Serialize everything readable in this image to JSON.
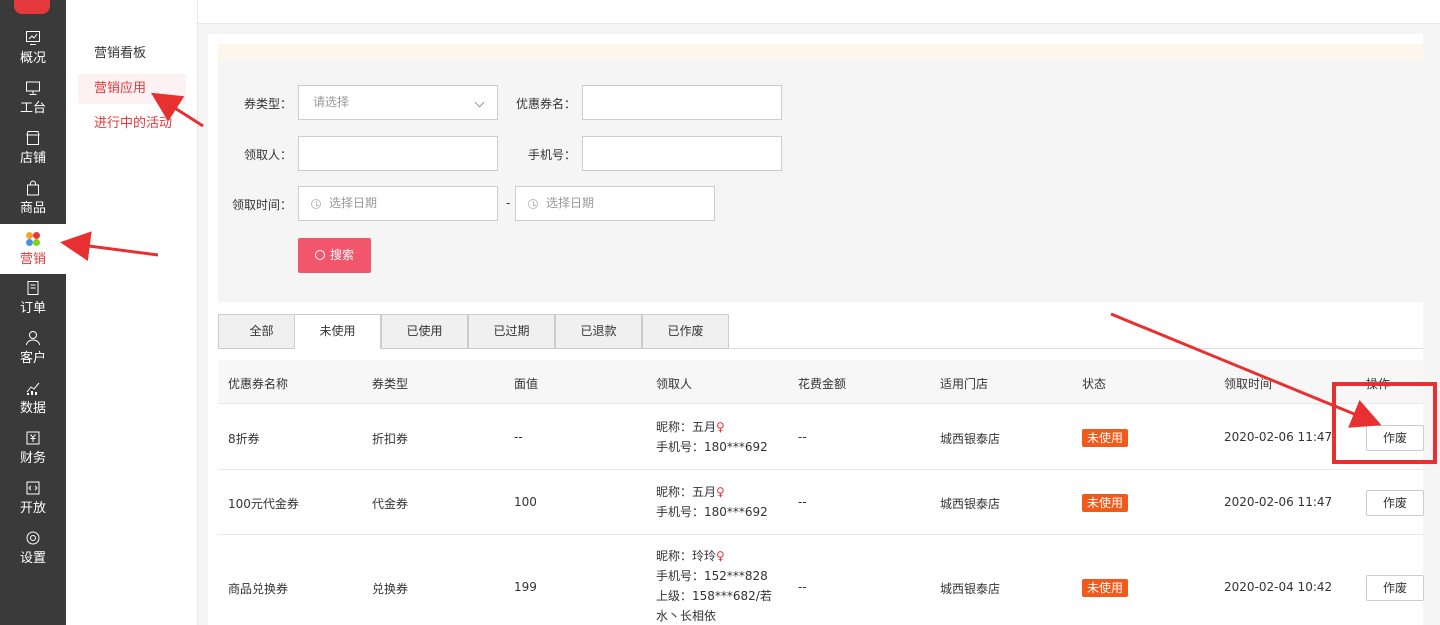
{
  "nav": {
    "items": [
      {
        "label": "概况",
        "icon": "dashboard-icon"
      },
      {
        "label": "工台",
        "icon": "desktop-icon"
      },
      {
        "label": "店铺",
        "icon": "store-icon"
      },
      {
        "label": "商品",
        "icon": "bag-icon"
      },
      {
        "label": "营销",
        "icon": "marketing-icon"
      },
      {
        "label": "订单",
        "icon": "order-icon"
      },
      {
        "label": "客户",
        "icon": "user-icon"
      },
      {
        "label": "数据",
        "icon": "chart-icon"
      },
      {
        "label": "财务",
        "icon": "finance-icon"
      },
      {
        "label": "开放",
        "icon": "code-icon"
      },
      {
        "label": "设置",
        "icon": "gear-icon"
      }
    ]
  },
  "submenu": {
    "items": [
      "营销看板",
      "营销应用",
      "进行中的活动"
    ]
  },
  "filter": {
    "coupon_type_label": "券类型：",
    "coupon_type_placeholder": "请选择",
    "coupon_name_label": "优惠券名：",
    "receiver_label": "领取人：",
    "phone_label": "手机号：",
    "time_label": "领取时间：",
    "date_placeholder_start": "选择日期",
    "date_separator": "-",
    "date_placeholder_end": "选择日期",
    "search_button": "搜索"
  },
  "tabs": [
    "全部",
    "未使用",
    "已使用",
    "已过期",
    "已退款",
    "已作废"
  ],
  "table": {
    "headers": [
      "优惠券名称",
      "券类型",
      "面值",
      "领取人",
      "花费金额",
      "适用门店",
      "状态",
      "领取时间",
      "操作"
    ],
    "rows": [
      {
        "name": "8折券",
        "type": "折扣券",
        "value": "--",
        "nickname": "昵称：五月",
        "phone": "手机号：180***692",
        "cost": "--",
        "store": "城西银泰店",
        "status": "未使用",
        "time": "2020-02-06 11:47",
        "action": "作废"
      },
      {
        "name": "100元代金券",
        "type": "代金券",
        "value": "100",
        "nickname": "昵称：五月",
        "phone": "手机号：180***692",
        "cost": "--",
        "store": "城西银泰店",
        "status": "未使用",
        "time": "2020-02-06 11:47",
        "action": "作废"
      },
      {
        "name": "商品兑换券",
        "type": "兑换券",
        "value": "199",
        "nickname": "昵称：玲玲",
        "phone": "手机号：152***828",
        "superior": "上级：158***682/若",
        "superior2": "水丶长相依",
        "cost": "--",
        "store": "城西银泰店",
        "status": "未使用",
        "time": "2020-02-04 10:42",
        "action": "作废"
      }
    ]
  },
  "colors": {
    "accent": "#e4393c",
    "search_button": "#f1566d",
    "status_badge": "#f05a1a",
    "annotation": "#e83030",
    "nav_bg": "#3a3a3a"
  }
}
